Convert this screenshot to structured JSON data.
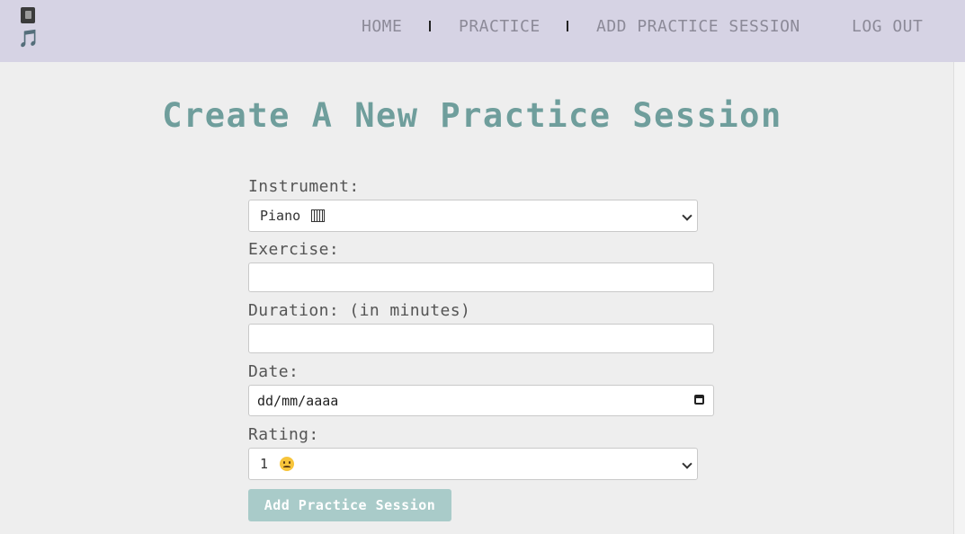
{
  "navbar": {
    "logo_emoji_note": "🎵",
    "items": [
      {
        "label": "HOME"
      },
      {
        "label": "PRACTICE"
      },
      {
        "label": "ADD PRACTICE SESSION"
      },
      {
        "label": "LOG OUT"
      }
    ]
  },
  "page": {
    "title": "Create A New Practice Session"
  },
  "form": {
    "instrument": {
      "label": "Instrument:",
      "selected": "Piano",
      "selected_icon": "piano-keys-icon"
    },
    "exercise": {
      "label": "Exercise:",
      "value": ""
    },
    "duration": {
      "label": "Duration: (in minutes)",
      "value": ""
    },
    "date": {
      "label": "Date:",
      "placeholder": "dd/mm/aaaa"
    },
    "rating": {
      "label": "Rating:",
      "selected": "1",
      "selected_icon": "confused-face-icon"
    },
    "submit_label": "Add Practice Session"
  },
  "colors": {
    "navbar_bg": "#d6d3e4",
    "nav_text": "#8c8a98",
    "title": "#6f9e9c",
    "button_bg": "#a9cbc9",
    "page_bg": "#eeeeee"
  }
}
